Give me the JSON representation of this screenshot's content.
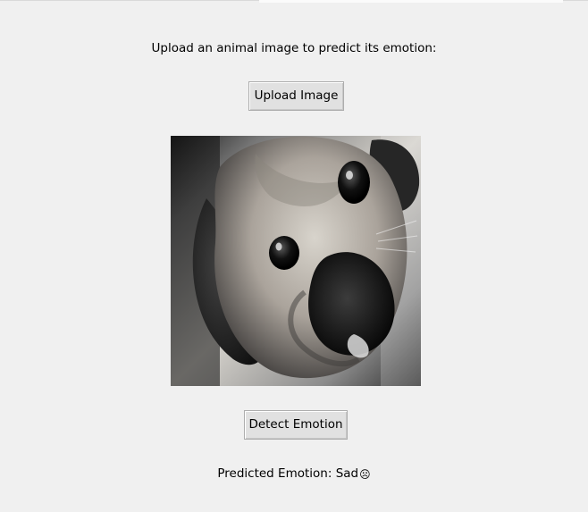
{
  "app": {
    "prompt_text": "Upload an animal image to predict its emotion:",
    "upload_button_label": "Upload Image",
    "detect_button_label": "Detect Emotion",
    "image_alt": "Uploaded dog image",
    "result": {
      "prefix": "Predicted Emotion: ",
      "value": "Sad",
      "emoji": "☹"
    }
  }
}
